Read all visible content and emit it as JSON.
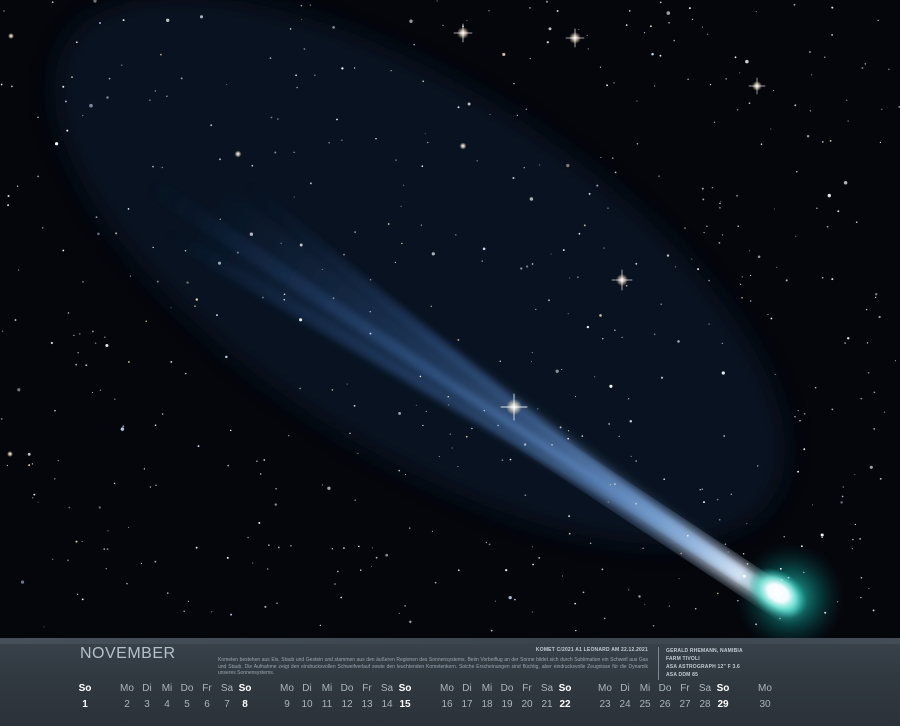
{
  "month": "NOVEMBER",
  "description": "Kometen bestehen aus Eis, Staub und Gestein und stammen aus den äußeren Regionen des Sonnensystems. Beim Vorbeiflug an der Sonne bildet sich durch Sublimation ein Schweif aus Gas und Staub. Die Aufnahme zeigt den eindrucksvollen Schweifverlauf sowie den leuchtenden Kometenkern. Solche Erscheinungen sind flüchtig, aber eindrucksvolle Zeugnisse für die Dynamik unseres Sonnensystems.",
  "caption": "KOMET C/2021 A1 LEONARD AM 22.12.2021",
  "credits": {
    "photographer": "GERALD RHEMANN, NAMIBIA",
    "location": "FARM TIVOLI",
    "telescope": "ASA ASTROGRAPH 12\" F 3.6",
    "mount": "ASA DDM 85"
  },
  "days": [
    {
      "wd": "So",
      "d": "1",
      "sun": true
    },
    {
      "wd": "Mo",
      "d": "2"
    },
    {
      "wd": "Di",
      "d": "3"
    },
    {
      "wd": "Mi",
      "d": "4"
    },
    {
      "wd": "Do",
      "d": "5"
    },
    {
      "wd": "Fr",
      "d": "6"
    },
    {
      "wd": "Sa",
      "d": "7"
    },
    {
      "wd": "So",
      "d": "8",
      "sun": true
    },
    {
      "wd": "Mo",
      "d": "9"
    },
    {
      "wd": "Di",
      "d": "10"
    },
    {
      "wd": "Mi",
      "d": "11"
    },
    {
      "wd": "Do",
      "d": "12"
    },
    {
      "wd": "Fr",
      "d": "13"
    },
    {
      "wd": "Sa",
      "d": "14"
    },
    {
      "wd": "So",
      "d": "15",
      "sun": true
    },
    {
      "wd": "Mo",
      "d": "16"
    },
    {
      "wd": "Di",
      "d": "17"
    },
    {
      "wd": "Mi",
      "d": "18"
    },
    {
      "wd": "Do",
      "d": "19"
    },
    {
      "wd": "Fr",
      "d": "20"
    },
    {
      "wd": "Sa",
      "d": "21"
    },
    {
      "wd": "So",
      "d": "22",
      "sun": true
    },
    {
      "wd": "Mo",
      "d": "23"
    },
    {
      "wd": "Di",
      "d": "24"
    },
    {
      "wd": "Mi",
      "d": "25"
    },
    {
      "wd": "Do",
      "d": "26"
    },
    {
      "wd": "Fr",
      "d": "27"
    },
    {
      "wd": "Sa",
      "d": "28"
    },
    {
      "wd": "So",
      "d": "29",
      "sun": true
    },
    {
      "wd": "Mo",
      "d": "30"
    }
  ]
}
